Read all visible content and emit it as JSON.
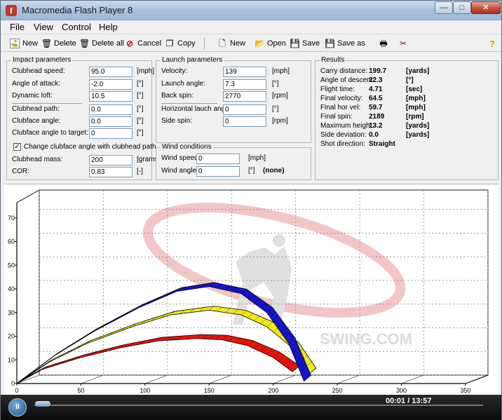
{
  "window": {
    "title": "Macromedia Flash Player 8",
    "min": "—",
    "max": "□",
    "close": "✕"
  },
  "menu": [
    "File",
    "View",
    "Control",
    "Help"
  ],
  "toolbar": {
    "new1": "New",
    "delete": "Delete",
    "delete_all": "Delete all",
    "cancel": "Cancel",
    "copy": "Copy",
    "new2": "New",
    "open": "Open",
    "save": "Save",
    "save_as": "Save as",
    "help": "?"
  },
  "impact": {
    "title": "Impact parameters",
    "rows": [
      {
        "label": "Clubhead speed:",
        "value": "95.0",
        "unit": "[mph]"
      },
      {
        "label": "Angle of attack:",
        "value": "-2.0",
        "unit": "[°]"
      },
      {
        "label": "Dynamic loft:",
        "value": "10.5",
        "unit": "[°]"
      },
      {
        "label": "Clubhead path:",
        "value": "0.0",
        "unit": "[°]"
      },
      {
        "label": "Clubface angle:",
        "value": "0.0",
        "unit": "[°]"
      },
      {
        "label": "Clubface angle to target:",
        "value": "0",
        "unit": "[°]"
      }
    ],
    "checkbox_label": "Change clubface angle with clubhead path",
    "checkbox_mark": "✓",
    "rows2": [
      {
        "label": "Clubhead mass:",
        "value": "200",
        "unit": "[grams]"
      },
      {
        "label": "COR:",
        "value": "0.83",
        "unit": "[-]"
      }
    ]
  },
  "launch": {
    "title": "Launch parameters",
    "rows": [
      {
        "label": "Velocity:",
        "value": "139",
        "unit": "[mph]"
      },
      {
        "label": "Launch angle:",
        "value": "7.3",
        "unit": "[°]"
      },
      {
        "label": "Back spin:",
        "value": "2770",
        "unit": "[rpm]"
      },
      {
        "label": "Horizontal lauch angle:",
        "value": "0",
        "unit": "[°]"
      },
      {
        "label": "Side spin:",
        "value": "0",
        "unit": "[rpm]"
      }
    ]
  },
  "wind": {
    "title": "Wind conditions",
    "rows": [
      {
        "label": "Wind speed:",
        "value": "0",
        "unit": "[mph]"
      },
      {
        "label": "Wind angle:",
        "value": "0",
        "unit": "[°]",
        "extra": "(none)"
      }
    ]
  },
  "results": {
    "title": "Results",
    "rows": [
      {
        "label": "Carry distance:",
        "value": "199.7",
        "unit": "[yards]"
      },
      {
        "label": "Angle of descent:",
        "value": "22.3",
        "unit": "[°]"
      },
      {
        "label": "Flight time:",
        "value": "4.71",
        "unit": "[sec]"
      },
      {
        "label": "Final velocity:",
        "value": "64.5",
        "unit": "[mph]"
      },
      {
        "label": "Final hor vel:",
        "value": "59.7",
        "unit": "[mph]"
      },
      {
        "label": "Final spin:",
        "value": "2189",
        "unit": "[rpm]"
      },
      {
        "label": "Maximum height:",
        "value": "13.2",
        "unit": "[yards]"
      },
      {
        "label": "Side deviation:",
        "value": "0.0",
        "unit": "[yards]"
      },
      {
        "label": "Shot direction:",
        "value": "Straight",
        "unit": ""
      }
    ]
  },
  "chart_data": {
    "type": "line",
    "xlim": [
      0,
      350
    ],
    "ylim": [
      0,
      80
    ],
    "x_ticks": [
      "0",
      "50",
      "100",
      "150",
      "200",
      "250",
      "300",
      "350"
    ],
    "y_ticks": [
      "0",
      "10",
      "20",
      "30",
      "40",
      "50",
      "60",
      "70"
    ],
    "grid": true,
    "watermark": "SWING.COM",
    "series": [
      {
        "color": "#e8140c",
        "x": [
          0,
          20,
          50,
          80,
          110,
          140,
          160,
          180,
          200,
          215
        ],
        "y": [
          0,
          6,
          11,
          15,
          18,
          19,
          18.5,
          16,
          11,
          5
        ]
      },
      {
        "color": "#f0e81a",
        "x": [
          0,
          25,
          55,
          90,
          120,
          150,
          175,
          195,
          215,
          228
        ],
        "y": [
          0,
          9,
          17,
          24,
          29,
          31,
          29,
          24,
          15,
          4
        ]
      },
      {
        "color": "#1414c8",
        "x": [
          0,
          30,
          60,
          95,
          125,
          150,
          175,
          195,
          212,
          224
        ],
        "y": [
          0,
          12,
          22,
          32,
          39,
          41,
          38,
          30,
          17,
          1
        ]
      }
    ]
  },
  "player": {
    "time": "00:01 / 13:57",
    "progress": 0.001,
    "play_label": "II"
  }
}
